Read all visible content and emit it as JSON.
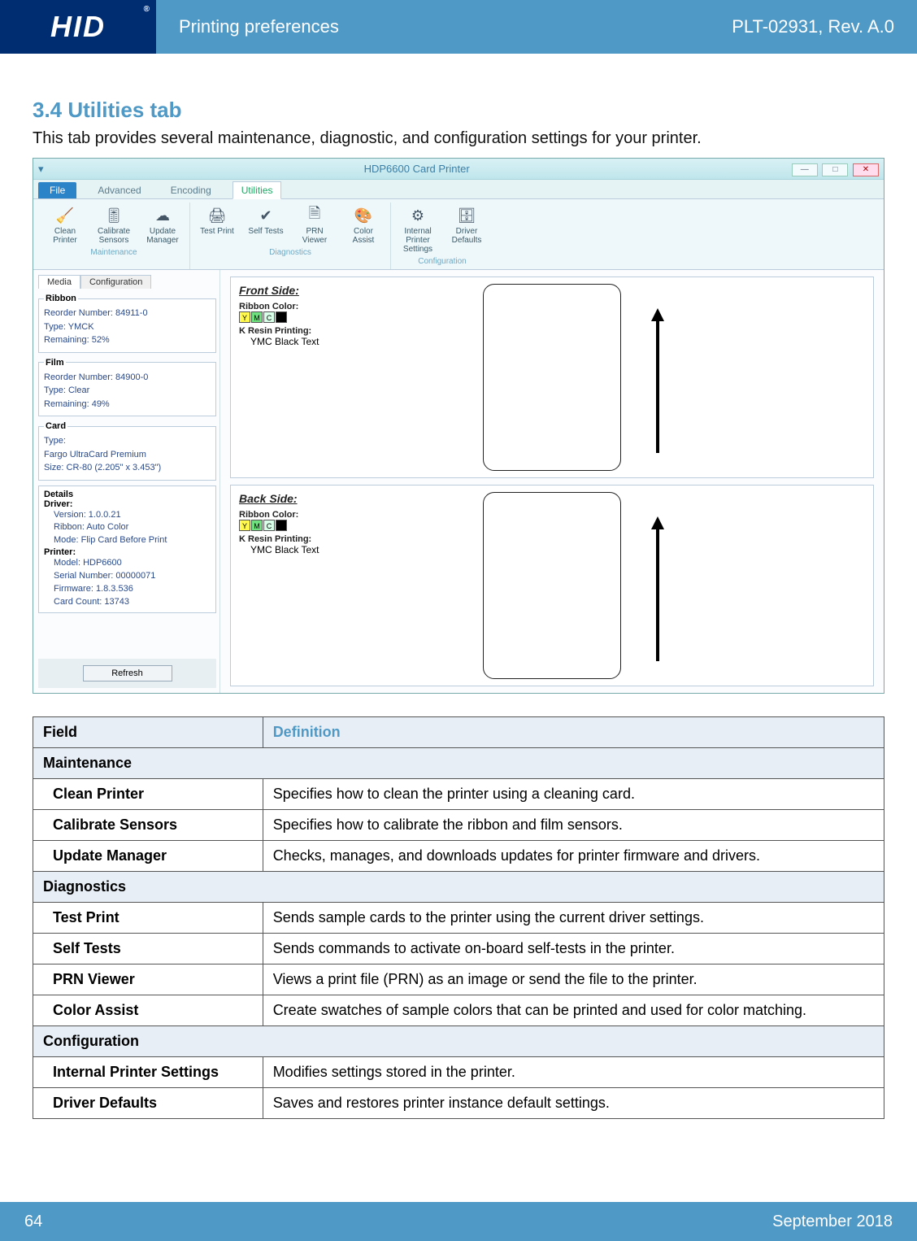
{
  "header": {
    "logo_text": "HID",
    "title": "Printing preferences",
    "revision": "PLT-02931, Rev. A.0"
  },
  "section": {
    "heading": "3.4 Utilities tab",
    "intro": "This tab provides several maintenance, diagnostic, and configuration settings for your printer."
  },
  "screenshot": {
    "window_title": "HDP6600 Card Printer",
    "menu": {
      "file": "File",
      "advanced": "Advanced",
      "encoding": "Encoding",
      "utilities": "Utilities"
    },
    "toolbar": {
      "maintenance": {
        "label": "Maintenance",
        "clean": "Clean Printer",
        "calibrate": "Calibrate Sensors",
        "update": "Update Manager"
      },
      "diagnostics": {
        "label": "Diagnostics",
        "test_print": "Test Print",
        "self_tests": "Self Tests",
        "prn_viewer": "PRN Viewer",
        "color_assist": "Color Assist"
      },
      "configuration": {
        "label": "Configuration",
        "ips": "Internal Printer Settings",
        "driver_defaults": "Driver Defaults"
      }
    },
    "subtabs": {
      "media": "Media",
      "configuration": "Configuration"
    },
    "ribbon": {
      "legend": "Ribbon",
      "reorder": "Reorder Number: 84911-0",
      "type": "Type: YMCK",
      "remaining": "Remaining: 52%"
    },
    "film": {
      "legend": "Film",
      "reorder": "Reorder Number: 84900-0",
      "type": "Type: Clear",
      "remaining": "Remaining: 49%"
    },
    "card": {
      "legend": "Card",
      "type": "Type:\n  Fargo UltraCard Premium",
      "size": "Size: CR-80 (2.205\" x 3.453\")"
    },
    "details": {
      "legend": "Details",
      "driver_label": "Driver:",
      "driver_version": "Version: 1.0.0.21",
      "driver_ribbon": "Ribbon: Auto Color",
      "driver_mode": "Mode: Flip Card Before Print",
      "printer_label": "Printer:",
      "printer_model": "Model: HDP6600",
      "printer_serial": "Serial Number: 00000071",
      "printer_fw": "Firmware: 1.8.3.536",
      "printer_count": "Card Count: 13743"
    },
    "refresh": "Refresh",
    "front": {
      "heading": "Front Side:",
      "ribbon_color_label": "Ribbon Color:",
      "kresin_label": "K Resin Printing:",
      "kresin_value": "YMC Black Text"
    },
    "back": {
      "heading": "Back Side:",
      "ribbon_color_label": "Ribbon Color:",
      "kresin_label": "K Resin Printing:",
      "kresin_value": "YMC Black Text"
    }
  },
  "table": {
    "head_field": "Field",
    "head_def": "Definition",
    "groups": [
      {
        "name": "Maintenance",
        "rows": [
          {
            "field": "Clean Printer",
            "def": "Specifies how to clean the printer using a cleaning card."
          },
          {
            "field": "Calibrate Sensors",
            "def": "Specifies how to calibrate the ribbon and film sensors."
          },
          {
            "field": "Update Manager",
            "def": "Checks, manages, and downloads updates for printer firmware and drivers."
          }
        ]
      },
      {
        "name": "Diagnostics",
        "rows": [
          {
            "field": "Test Print",
            "def": "Sends sample cards to the printer using the current driver settings."
          },
          {
            "field": "Self Tests",
            "def": "Sends commands to activate on-board self-tests in the printer."
          },
          {
            "field": "PRN Viewer",
            "def": "Views a print file (PRN) as an image or send the file to the printer."
          },
          {
            "field": "Color Assist",
            "def": "Create swatches of sample colors that can be printed and used for color matching."
          }
        ]
      },
      {
        "name": "Configuration",
        "rows": [
          {
            "field": "Internal Printer Settings",
            "def": "Modifies settings stored in the printer."
          },
          {
            "field": "Driver Defaults",
            "def": "Saves and restores printer instance default settings."
          }
        ]
      }
    ]
  },
  "footer": {
    "page": "64",
    "date": "September 2018"
  }
}
